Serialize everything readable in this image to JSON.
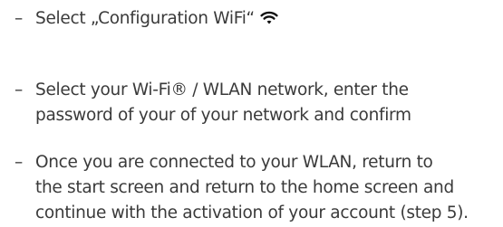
{
  "bullet": "–",
  "steps": [
    {
      "text": "Select „Configuration WiFi“",
      "icon": "wifi-icon"
    },
    {
      "text_line1": "Select your Wi-Fi® / WLAN network, enter the",
      "text_line2": "password of your of your network and confirm"
    },
    {
      "text_line1": "Once you are connected to your WLAN, return to",
      "text_line2": "the start screen and return to the home screen and",
      "text_line3": "continue with the activation of your account (step 5)."
    }
  ],
  "colors": {
    "text": "#3a3a3a",
    "icon": "#111111"
  }
}
